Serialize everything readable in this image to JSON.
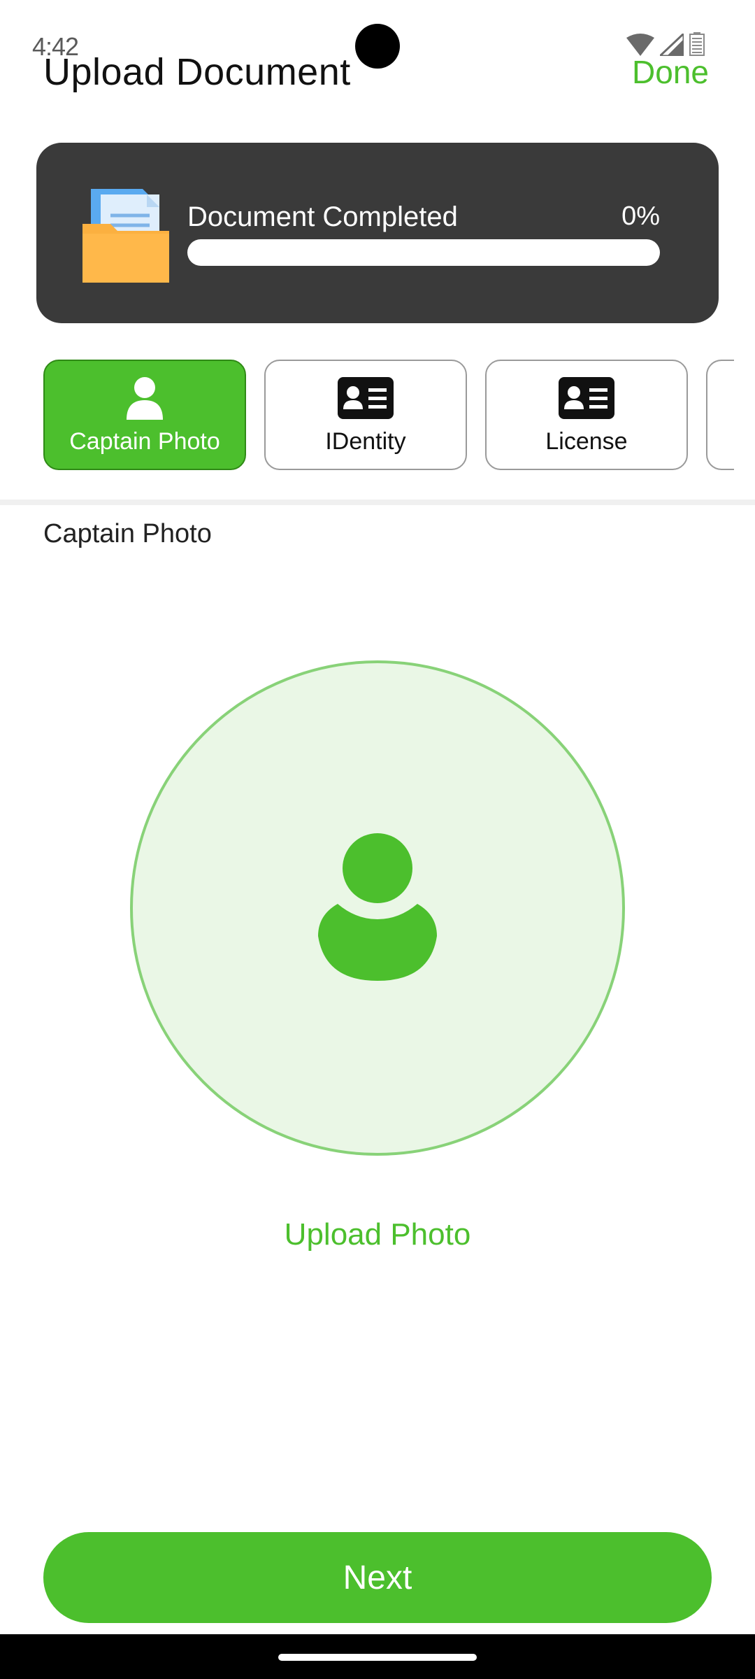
{
  "status_bar": {
    "time": "4:42",
    "icons": [
      "wifi-icon",
      "cell-signal-icon",
      "battery-icon"
    ]
  },
  "header": {
    "title": "Upload Document",
    "done_label": "Done"
  },
  "progress_card": {
    "label": "Document Completed",
    "percent_text": "0%",
    "progress_fraction": 0,
    "icon": "folder-document-icon"
  },
  "tabs": [
    {
      "label": "Captain Photo",
      "icon": "person-icon",
      "active": true
    },
    {
      "label": "IDentity",
      "icon": "id-card-icon",
      "active": false
    },
    {
      "label": "License",
      "icon": "id-card-icon",
      "active": false
    }
  ],
  "section": {
    "title": "Captain Photo"
  },
  "upload": {
    "label": "Upload Photo",
    "icon": "person-icon"
  },
  "footer": {
    "next_label": "Next"
  },
  "colors": {
    "accent": "#4cbf2d",
    "card_bg": "#3a3a3a",
    "circle_bg": "#eaf7e6",
    "circle_border": "#88d278"
  }
}
